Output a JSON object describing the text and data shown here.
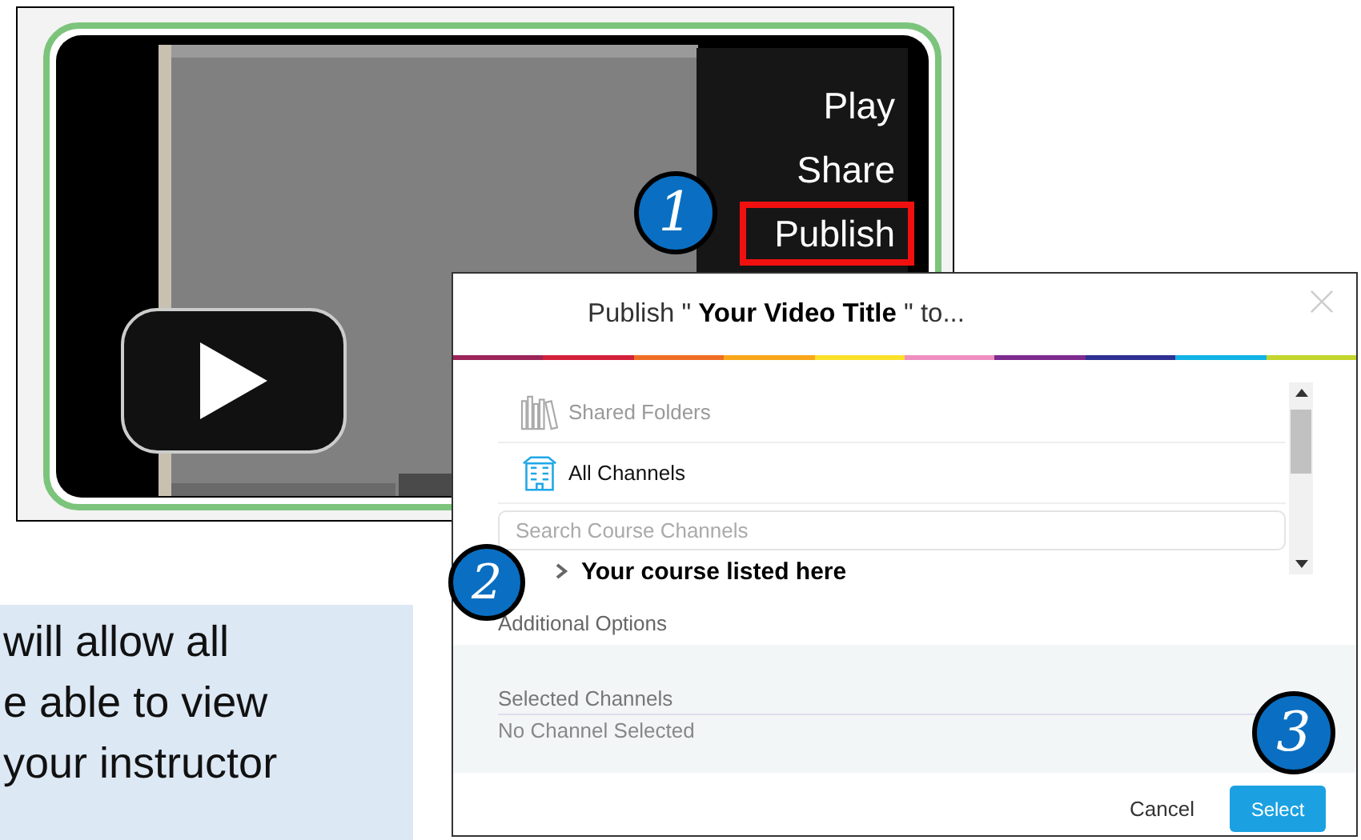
{
  "video_card": {
    "menu": [
      {
        "label": "Play",
        "selected": false
      },
      {
        "label": "Share",
        "selected": false
      },
      {
        "label": "Publish",
        "selected": true
      }
    ]
  },
  "dialog": {
    "title": "Publish \" **Your Video Title** \" to...",
    "locations": [
      {
        "label": "Shared Folders",
        "kind": "folders",
        "disabled": true
      },
      {
        "label": "All Channels",
        "kind": "channels",
        "disabled": false
      }
    ],
    "search": {
      "placeholder": "Search Course Channels"
    },
    "course": {
      "label": "Your course listed here",
      "expanded": false
    },
    "additional_options": "Additional Options",
    "selected_channels": {
      "heading": "Selected Channels",
      "value": "No Channel Selected"
    },
    "buttons": [
      {
        "label": "Cancel",
        "kind": "secondary"
      },
      {
        "label": "Select",
        "kind": "primary"
      }
    ]
  },
  "step_markers": [
    {
      "label": "1"
    },
    {
      "label": "2"
    },
    {
      "label": "3"
    }
  ],
  "callout": {
    "lines": [
      "will allow all",
      "e able to view",
      "your instructor"
    ]
  }
}
